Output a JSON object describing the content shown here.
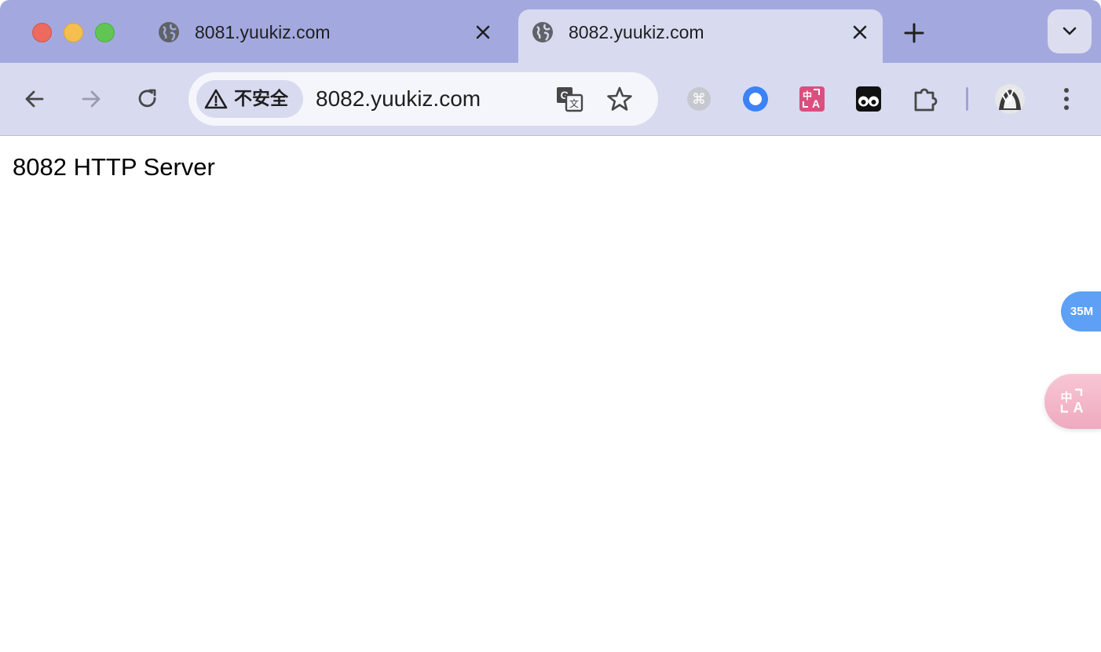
{
  "window": {
    "controls": [
      "close",
      "minimize",
      "zoom"
    ]
  },
  "tabs": [
    {
      "title": "8081.yuukiz.com",
      "favicon": "globe-icon",
      "active": false
    },
    {
      "title": "8082.yuukiz.com",
      "favicon": "globe-icon",
      "active": true
    }
  ],
  "toolbar": {
    "security_chip": "不安全",
    "url": "8082.yuukiz.com",
    "extensions": [
      "command-extension-icon",
      "circle-extension-icon",
      "translate-extension-icon",
      "eyes-extension-icon",
      "puzzle-icon"
    ]
  },
  "page": {
    "text": "8082 HTTP Server",
    "float_badge": "35M"
  },
  "colors": {
    "tabstrip": "#a3a9df",
    "toolbar": "#d8daf0",
    "omnibox": "#f5f6fb",
    "badge": "#5ea0f5",
    "translate_ext": "#d9507e"
  }
}
